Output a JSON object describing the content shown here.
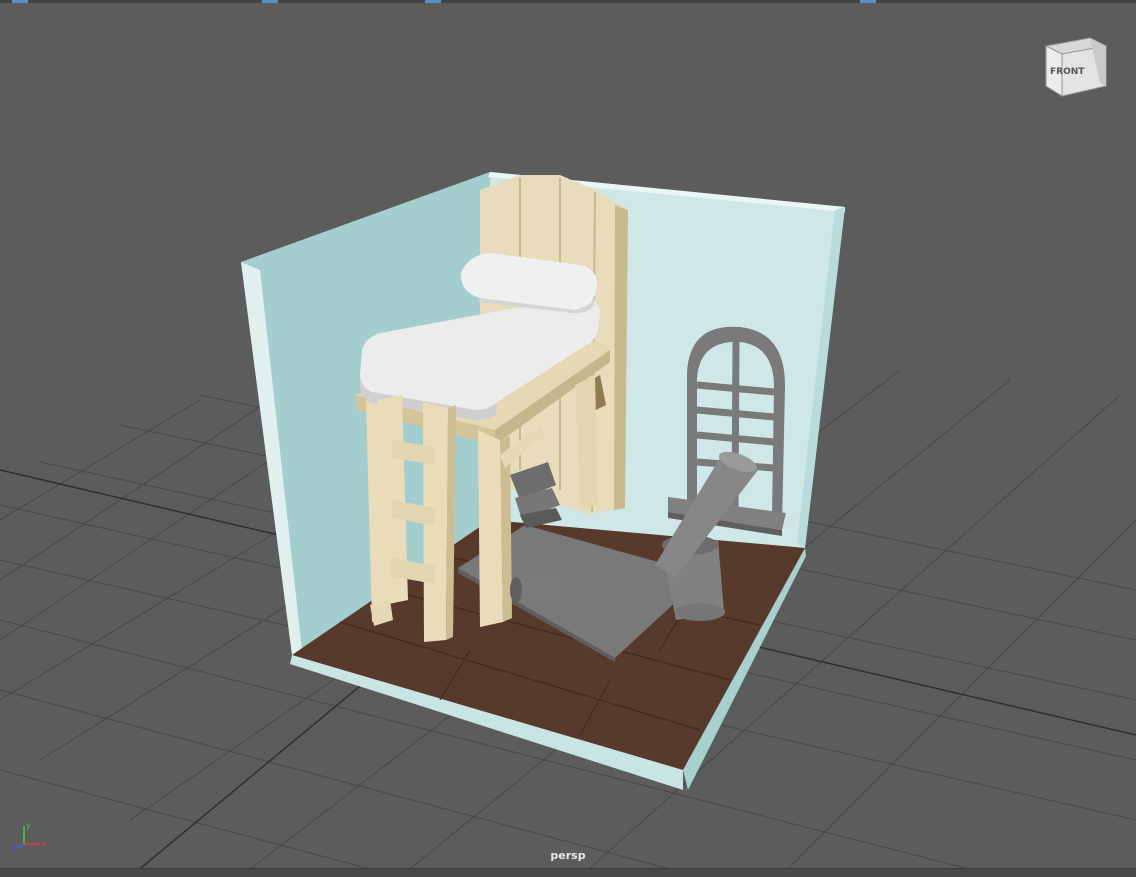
{
  "viewport": {
    "camera_label": "persp",
    "background_color": "#5c5c5c",
    "grid_color": "#3f3f3f"
  },
  "viewcube": {
    "face_label": "FRONT"
  },
  "axis_gizmo": {
    "x_label": "x",
    "y_label": "y",
    "z_label": "z",
    "x_color": "#e04040",
    "y_color": "#40d040",
    "z_color": "#4060ff"
  },
  "scene_objects": [
    "room-walls",
    "floor-planks",
    "loft-bed",
    "mattress",
    "pillow",
    "ladder",
    "arched-window",
    "rug",
    "telescope",
    "books"
  ]
}
